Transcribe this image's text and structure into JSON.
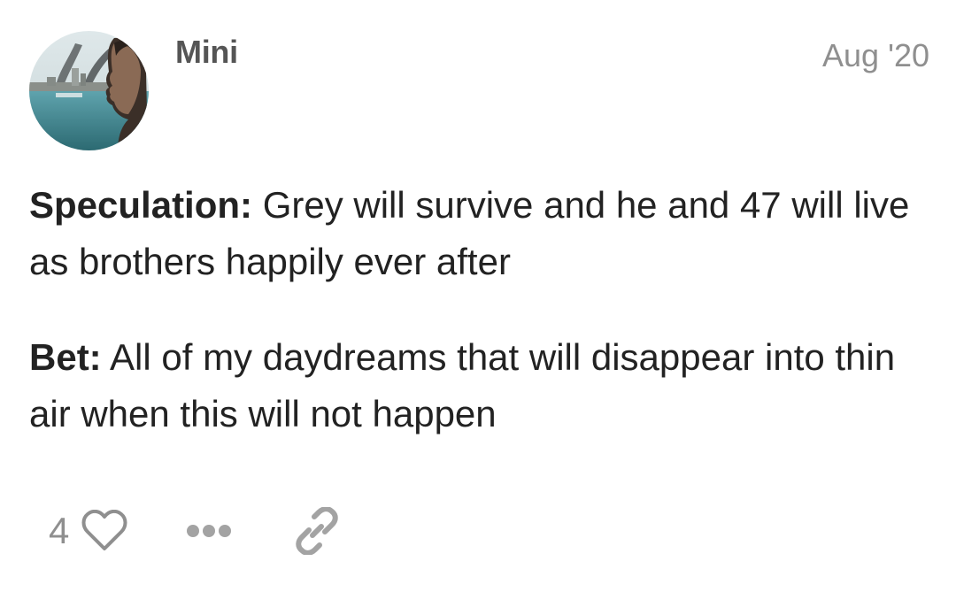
{
  "post": {
    "author": {
      "username": "Mini",
      "avatar_icon": "avatar-image"
    },
    "date": "Aug '20",
    "paragraphs": [
      {
        "label": "Speculation:",
        "text": " Grey will survive and he and 47 will live as brothers happily ever after"
      },
      {
        "label": "Bet:",
        "text": " All of my daydreams that will disappear into thin air when this will not happen"
      }
    ],
    "actions": {
      "like_count": "4",
      "like_icon": "heart-icon",
      "more_icon": "more-icon",
      "link_icon": "link-icon"
    },
    "colors": {
      "muted": "#8f8f8f",
      "text": "#222222",
      "username": "#555555"
    }
  }
}
